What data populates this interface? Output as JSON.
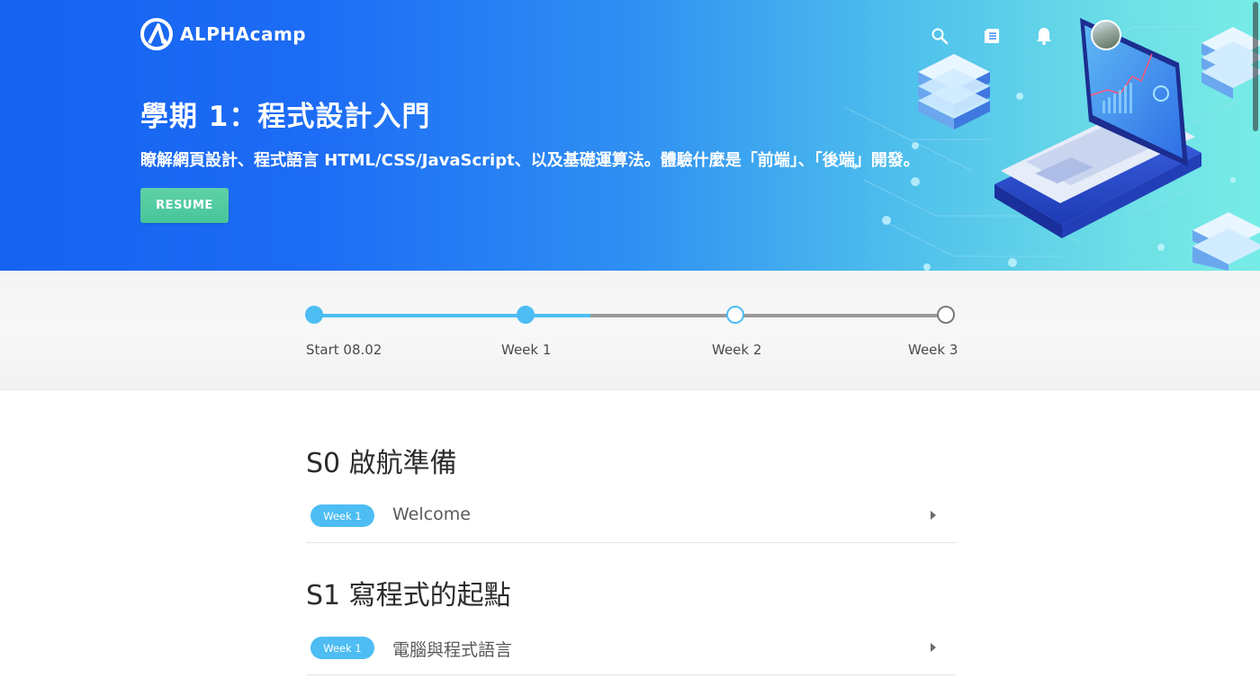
{
  "brand": {
    "logo_text_alpha": "ALPHA",
    "logo_text_camp": "camp"
  },
  "header": {
    "icons": [
      "search-icon",
      "notebook-icon",
      "bell-icon"
    ],
    "avatar": "user-avatar"
  },
  "hero": {
    "title": "學期 1：程式設計入門",
    "description": "瞭解網頁設計、程式語言 HTML/CSS/JavaScript、以及基礎運算法。體驗什麼是「前端」、「後端」開發。",
    "resume_label": "RESUME"
  },
  "timeline": {
    "steps": [
      {
        "label": "Start 08.02",
        "state": "completed"
      },
      {
        "label": "Week 1",
        "state": "completed"
      },
      {
        "label": "Week 2",
        "state": "current"
      },
      {
        "label": "Week 3",
        "state": "upcoming"
      }
    ]
  },
  "sections": [
    {
      "title": "S0 啟航準備",
      "lessons": [
        {
          "badge": "Week 1",
          "title": "Welcome"
        }
      ]
    },
    {
      "title": "S1 寫程式的起點",
      "lessons": [
        {
          "badge": "Week 1",
          "title": "電腦與程式語言"
        }
      ]
    }
  ],
  "colors": {
    "hero_gradient_start": "#1563f0",
    "hero_gradient_end": "#76ece6",
    "accent_blue": "#4dbdf3",
    "resume_green": "#4ec99e",
    "timeline_upcoming": "#9a9a9a"
  }
}
